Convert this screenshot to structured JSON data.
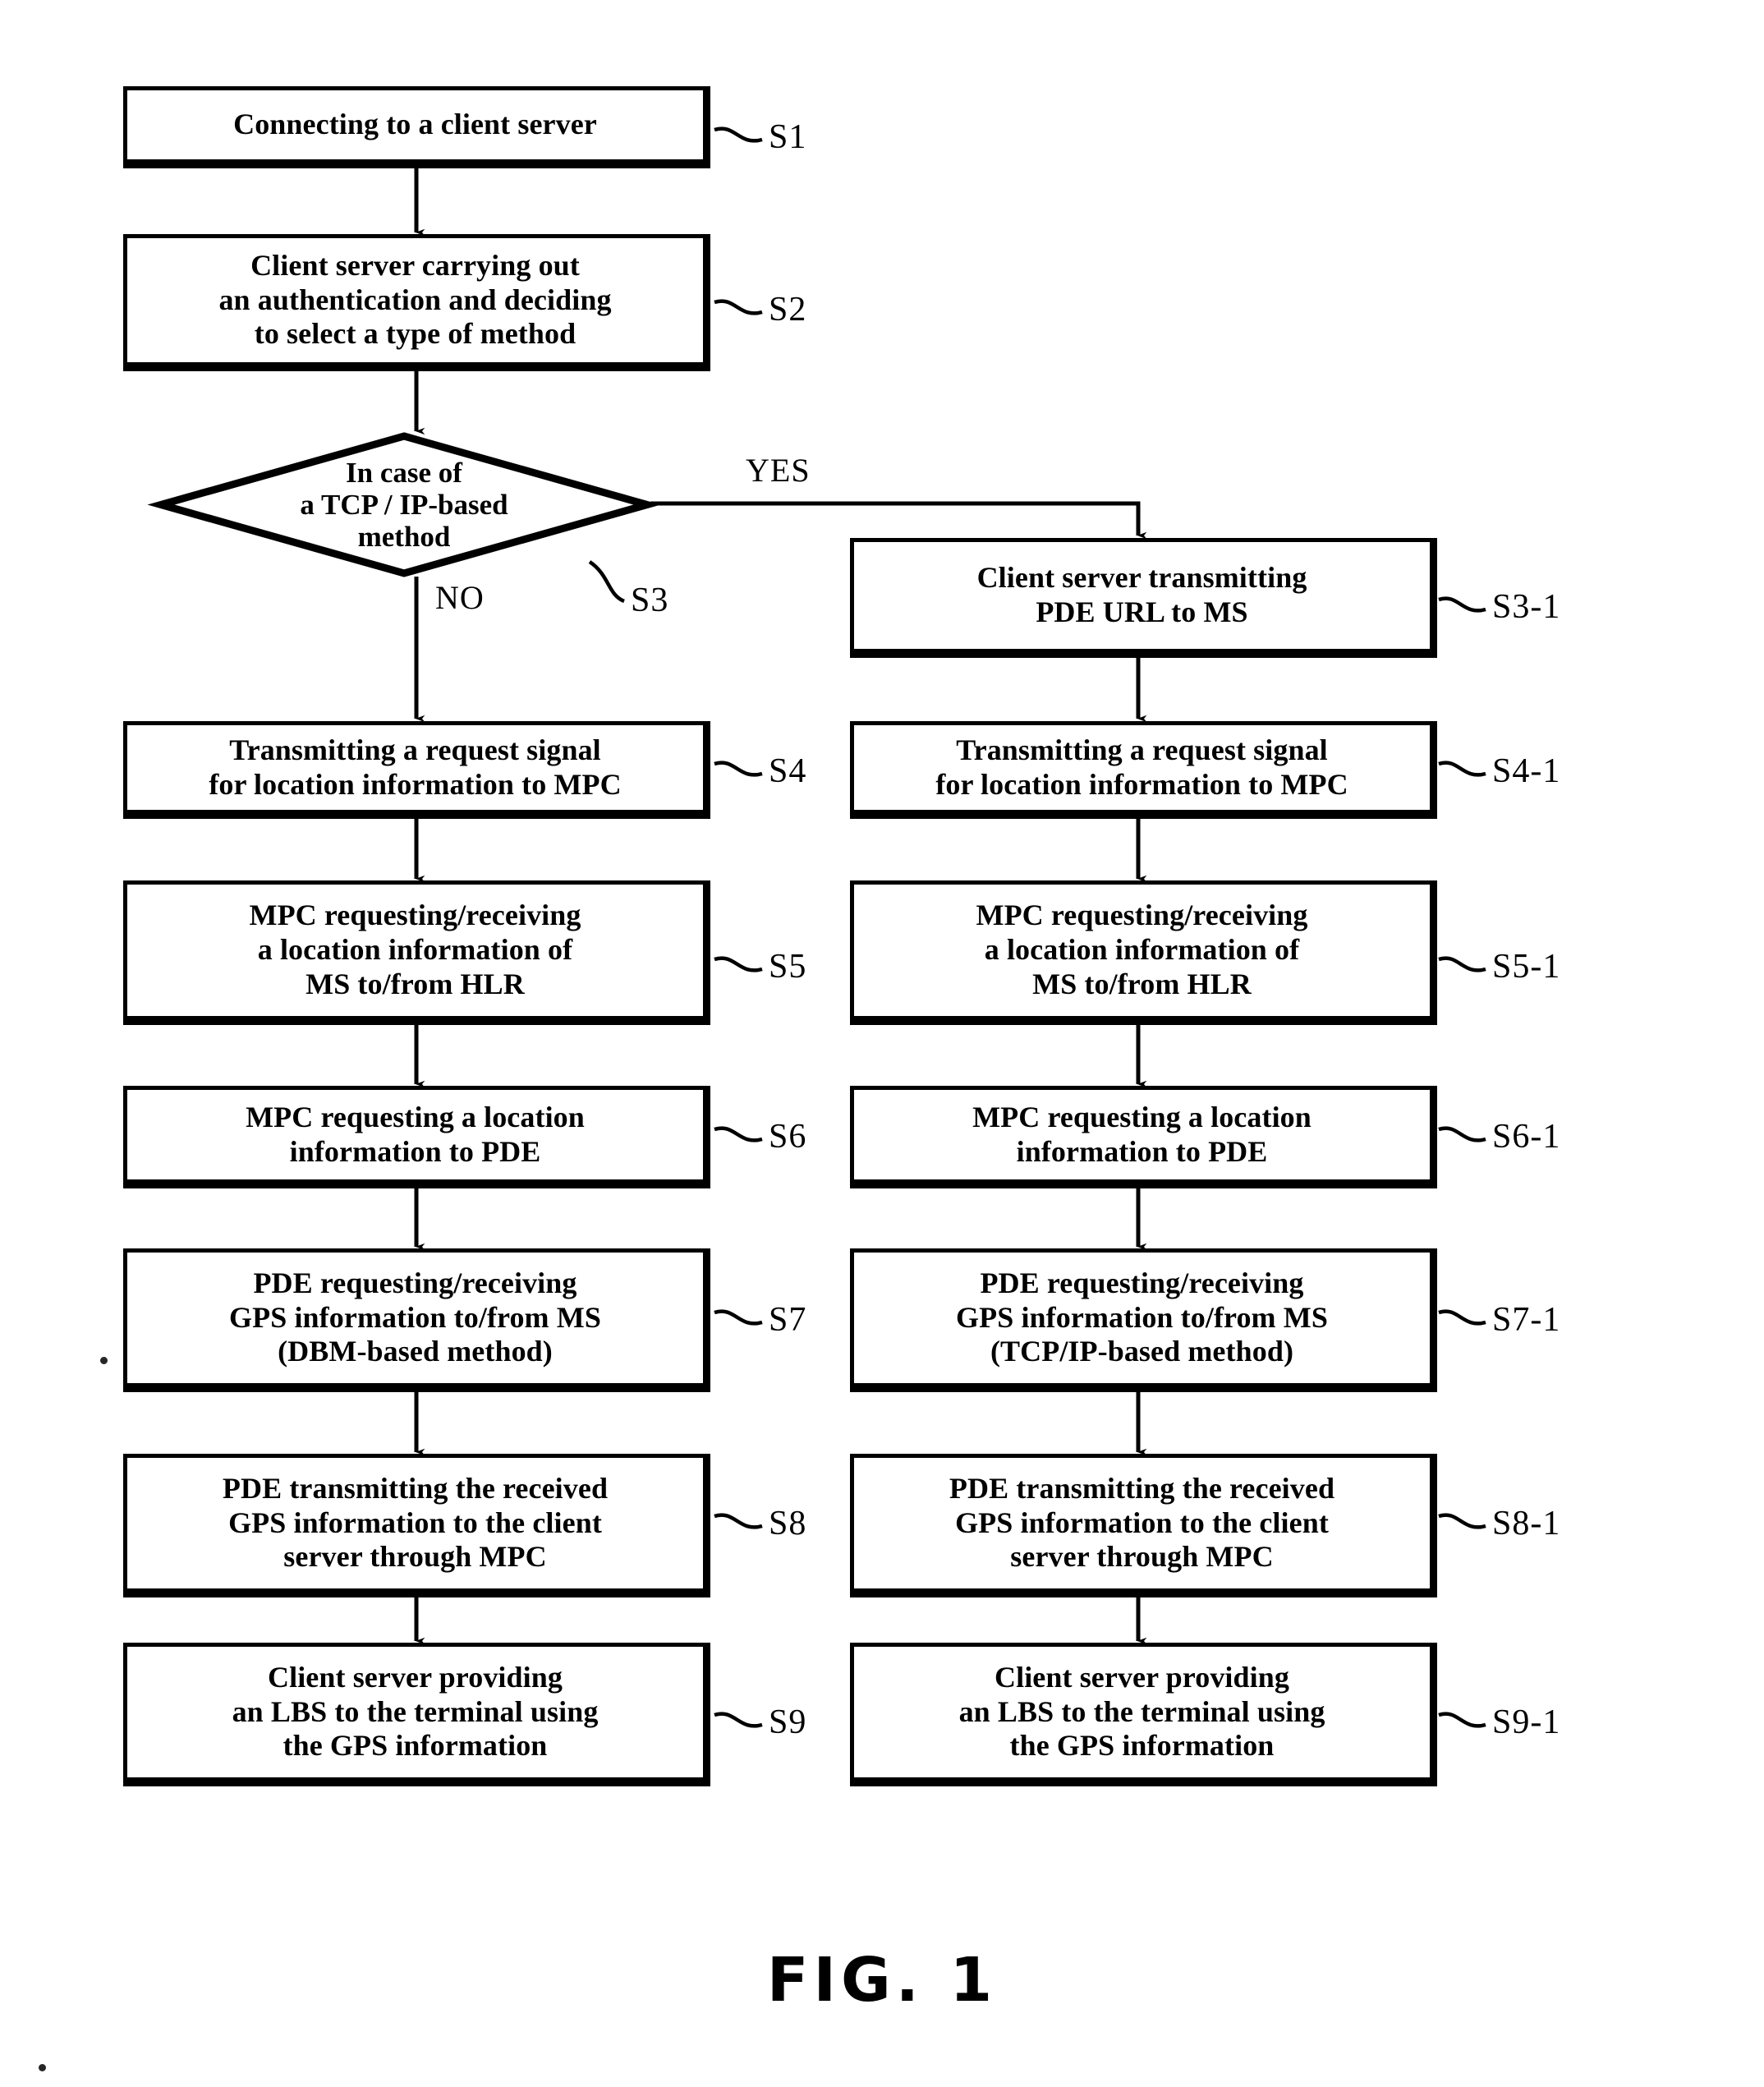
{
  "figure": {
    "caption": "FIG. 1",
    "title_text": "FIG. 1"
  },
  "branch_labels": {
    "yes": "YES",
    "no": "NO"
  },
  "decision": {
    "id": "S3",
    "text": "In case of\na TCP / IP-based\nmethod",
    "label": "S3"
  },
  "nodes": {
    "s1": {
      "text": "Connecting to a client server",
      "label": "S1"
    },
    "s2": {
      "text": "Client server carrying out\nan authentication and deciding\nto select a type of method",
      "label": "S2"
    },
    "s3_1": {
      "text": "Client server transmitting\nPDE URL to MS",
      "label": "S3-1"
    },
    "s4": {
      "text": "Transmitting a request signal\nfor location information to MPC",
      "label": "S4"
    },
    "s4_1": {
      "text": "Transmitting a request signal\nfor location information to MPC",
      "label": "S4-1"
    },
    "s5": {
      "text": "MPC requesting/receiving\na location information of\nMS to/from HLR",
      "label": "S5"
    },
    "s5_1": {
      "text": "MPC requesting/receiving\na location information of\nMS to/from HLR",
      "label": "S5-1"
    },
    "s6": {
      "text": "MPC requesting a location\ninformation to PDE",
      "label": "S6"
    },
    "s6_1": {
      "text": "MPC requesting a location\ninformation to PDE",
      "label": "S6-1"
    },
    "s7": {
      "text": "PDE requesting/receiving\nGPS information to/from MS\n(DBM-based method)",
      "label": "S7"
    },
    "s7_1": {
      "text": "PDE requesting/receiving\nGPS information to/from MS\n(TCP/IP-based method)",
      "label": "S7-1"
    },
    "s8": {
      "text": "PDE transmitting the received\nGPS information to the client\nserver through MPC",
      "label": "S8"
    },
    "s8_1": {
      "text": "PDE transmitting the received\nGPS information to the client\nserver through MPC",
      "label": "S8-1"
    },
    "s9": {
      "text": "Client server providing\nan LBS to the terminal using\nthe GPS information",
      "label": "S9"
    },
    "s9_1": {
      "text": "Client server providing\nan LBS to the terminal using\nthe GPS information",
      "label": "S9-1"
    }
  },
  "colors": {
    "ink": "#000000",
    "paper": "#ffffff"
  }
}
